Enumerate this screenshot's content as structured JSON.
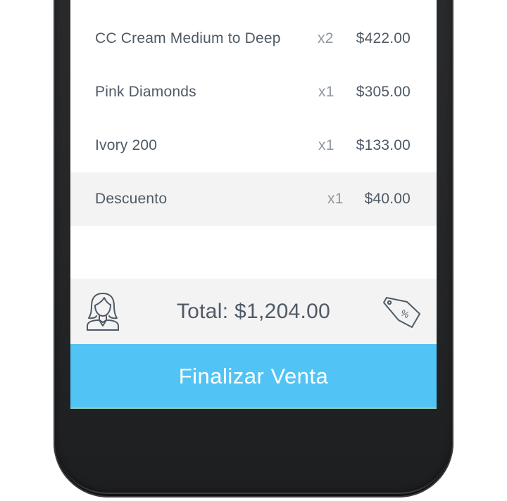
{
  "items": [
    {
      "name": "CC Cream Medium to Deep",
      "qty": "x2",
      "price": "$422.00"
    },
    {
      "name": "Pink Diamonds",
      "qty": "x1",
      "price": "$305.00"
    },
    {
      "name": "Ivory 200",
      "qty": "x1",
      "price": "$133.00"
    }
  ],
  "discount": {
    "name": "Descuento",
    "qty": "x1",
    "price": "$40.00"
  },
  "footer": {
    "total_label": "Total: $1,204.00",
    "customer_icon": "customer-avatar-icon",
    "discount_icon": "discount-tag-icon"
  },
  "action": {
    "finish_label": "Finalizar Venta"
  },
  "colors": {
    "accent": "#52c3f5",
    "text": "#4f5a66",
    "muted": "#8f979f",
    "panel": "#f3f3f3",
    "device": "#242527"
  }
}
